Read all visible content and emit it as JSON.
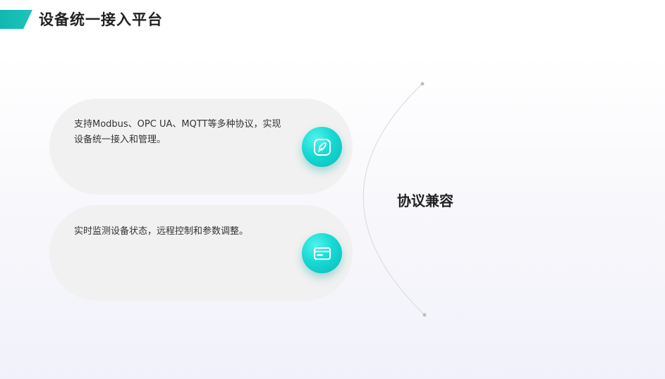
{
  "header": {
    "title": "设备统一接入平台"
  },
  "cards": [
    {
      "text": "支持Modbus、OPC UA、MQTT等多种协议，实现设备统一接入和管理。",
      "icon": "edit-icon"
    },
    {
      "text": "实时监测设备状态，远程控制和参数调整。",
      "icon": "card-icon"
    }
  ],
  "feature": {
    "title": "协议兼容"
  },
  "colors": {
    "accent": "#1cc4bb",
    "icon_gradient_light": "#4ff3ec",
    "icon_gradient_dark": "#0bbab9",
    "card_bg": "#f1f1f1",
    "title_text": "#222222"
  }
}
